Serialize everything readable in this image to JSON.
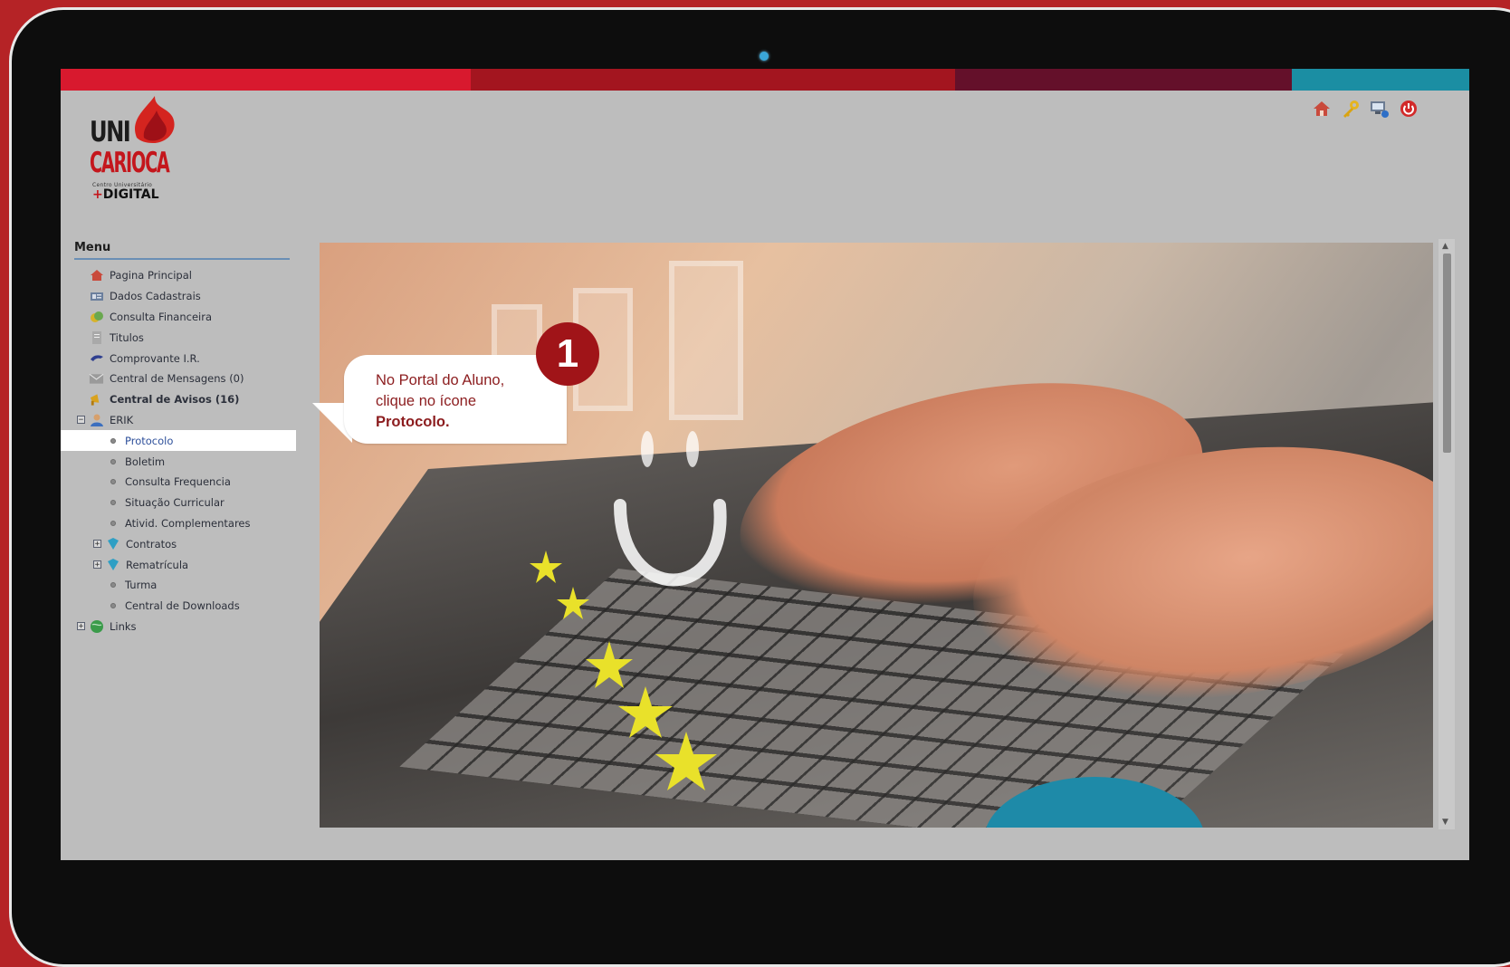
{
  "brand": {
    "logo_line1": "UNI",
    "logo_line2": "CARIOCA",
    "logo_sub": "Centro Universitário",
    "logo_plus": "+",
    "logo_digital": "DIGITAL"
  },
  "colors": {
    "background": "#b52326",
    "topbar": [
      "#d8192e",
      "#a3151f",
      "#64102a",
      "#1b8ea3"
    ],
    "accent_red": "#c4161c",
    "active_link": "#2d4f9a"
  },
  "toolbar": {
    "icons": [
      "home-icon",
      "key-icon",
      "monitor-icon",
      "power-icon"
    ]
  },
  "menu": {
    "title": "Menu",
    "items": [
      {
        "label": "Pagina Principal",
        "icon": "home-icon"
      },
      {
        "label": "Dados Cadastrais",
        "icon": "id-card-icon"
      },
      {
        "label": "Consulta Financeira",
        "icon": "coins-icon"
      },
      {
        "label": "Titulos",
        "icon": "document-icon"
      },
      {
        "label": "Comprovante I.R.",
        "icon": "receipt-icon"
      },
      {
        "label": "Central de Mensagens (0)",
        "icon": "mail-icon"
      },
      {
        "label": "Central de Avisos (16)",
        "icon": "megaphone-icon"
      },
      {
        "label": "ERIK",
        "icon": "user-icon",
        "expander": "−"
      },
      {
        "label": "Protocolo",
        "active": true
      },
      {
        "label": "Boletim"
      },
      {
        "label": "Consulta Frequencia"
      },
      {
        "label": "Situação Curricular"
      },
      {
        "label": "Ativid. Complementares"
      },
      {
        "label": "Contratos",
        "icon": "folder-icon",
        "expander": "+"
      },
      {
        "label": "Rematrícula",
        "icon": "folder-icon",
        "expander": "+"
      },
      {
        "label": "Turma"
      },
      {
        "label": "Central de Downloads"
      },
      {
        "label": "Links",
        "icon": "globe-icon",
        "expander": "+"
      }
    ]
  },
  "callout": {
    "step": "1",
    "line1": "No Portal do Aluno,",
    "line2": "clique no ícone",
    "emphasis": "Protocolo."
  },
  "scroll": {
    "up": "▲",
    "down": "▼"
  }
}
